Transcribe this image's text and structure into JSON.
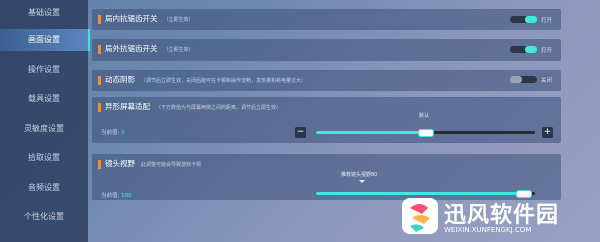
{
  "sidebar": {
    "items": [
      {
        "label": "基础设置",
        "active": false
      },
      {
        "label": "画面设置",
        "active": true
      },
      {
        "label": "操作设置",
        "active": false
      },
      {
        "label": "载具设置",
        "active": false
      },
      {
        "label": "灵敏度设置",
        "active": false
      },
      {
        "label": "拾取设置",
        "active": false
      },
      {
        "label": "音频设置",
        "active": false
      },
      {
        "label": "个性化设置",
        "active": false
      }
    ]
  },
  "settings": {
    "indoor_aa": {
      "title": "局内抗锯齿开关",
      "hint": "（立即生效）",
      "state": "打开",
      "on": true
    },
    "outdoor_aa": {
      "title": "局外抗锯齿开关",
      "hint": "（立即生效）",
      "state": "打开",
      "on": true
    },
    "dynamic_shadow": {
      "title": "动态阴影",
      "hint": "（调节后立即生效，关闭后能可在卡顿和操作流畅，发热量和耗电量过大）",
      "state": "关闭",
      "on": false
    },
    "notch_adapt": {
      "title": "异形屏幕适配",
      "hint": "（下方数值为与屏幕两侧之间的距离，调节后立即生效）",
      "value_label": "当前值:",
      "value": "0",
      "marker": "默认",
      "value_fraction": 0.5,
      "minus": "−",
      "plus": "+"
    },
    "camera_fov": {
      "title": "镜头视野",
      "hint": "此调整可能会导致游戏卡顿",
      "value_label": "当前值:",
      "value": "100",
      "marker": "推荐镜头视野80",
      "value_fraction": 0.95
    }
  },
  "watermark": {
    "name": "迅风软件园",
    "url": "WEIXIN.XUNFENGKJ.COM",
    "colors": [
      "#ff4f6d",
      "#ffb347",
      "#3fd1c8"
    ]
  }
}
